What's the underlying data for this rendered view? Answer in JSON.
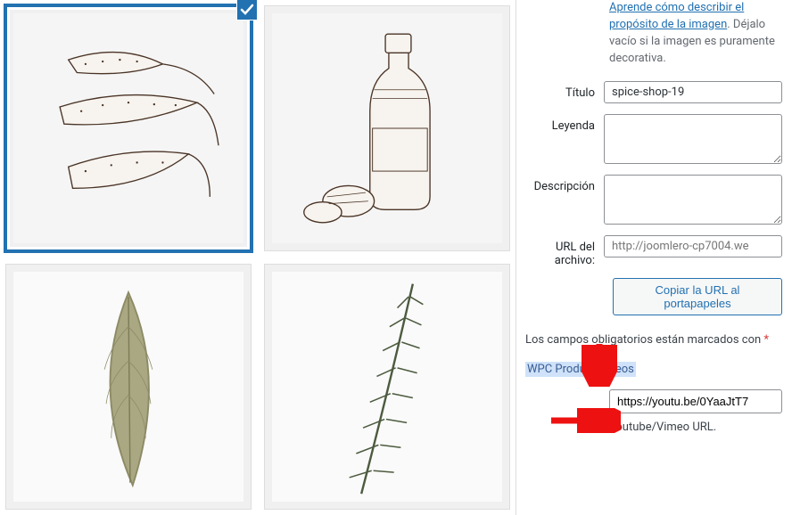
{
  "alt_help": {
    "link_text": "Aprende cómo describir el propósito de la imagen",
    "suffix": ". Déjalo vacío si la imagen es puramente decorativa."
  },
  "fields": {
    "title_label": "Título",
    "title_value": "spice-shop-19",
    "caption_label": "Leyenda",
    "caption_value": "",
    "description_label": "Descripción",
    "description_value": "",
    "file_url_label": "URL del archivo:",
    "file_url_value": "http://joomlero-cp7004.we",
    "copy_button": "Copiar la URL al portapapeles"
  },
  "required_note": {
    "text": "Los campos obligatorios están marcados con ",
    "asterisk": "*"
  },
  "wpc": {
    "heading": "WPC Product Videos",
    "url_value": "https://youtu.be/0YaaJtT7",
    "help": "Youtube/Vimeo URL."
  },
  "thumbs": [
    {
      "name": "media-thumb-1",
      "selected": true
    },
    {
      "name": "media-thumb-2",
      "selected": false
    },
    {
      "name": "media-thumb-3",
      "selected": false
    },
    {
      "name": "media-thumb-4",
      "selected": false
    }
  ]
}
